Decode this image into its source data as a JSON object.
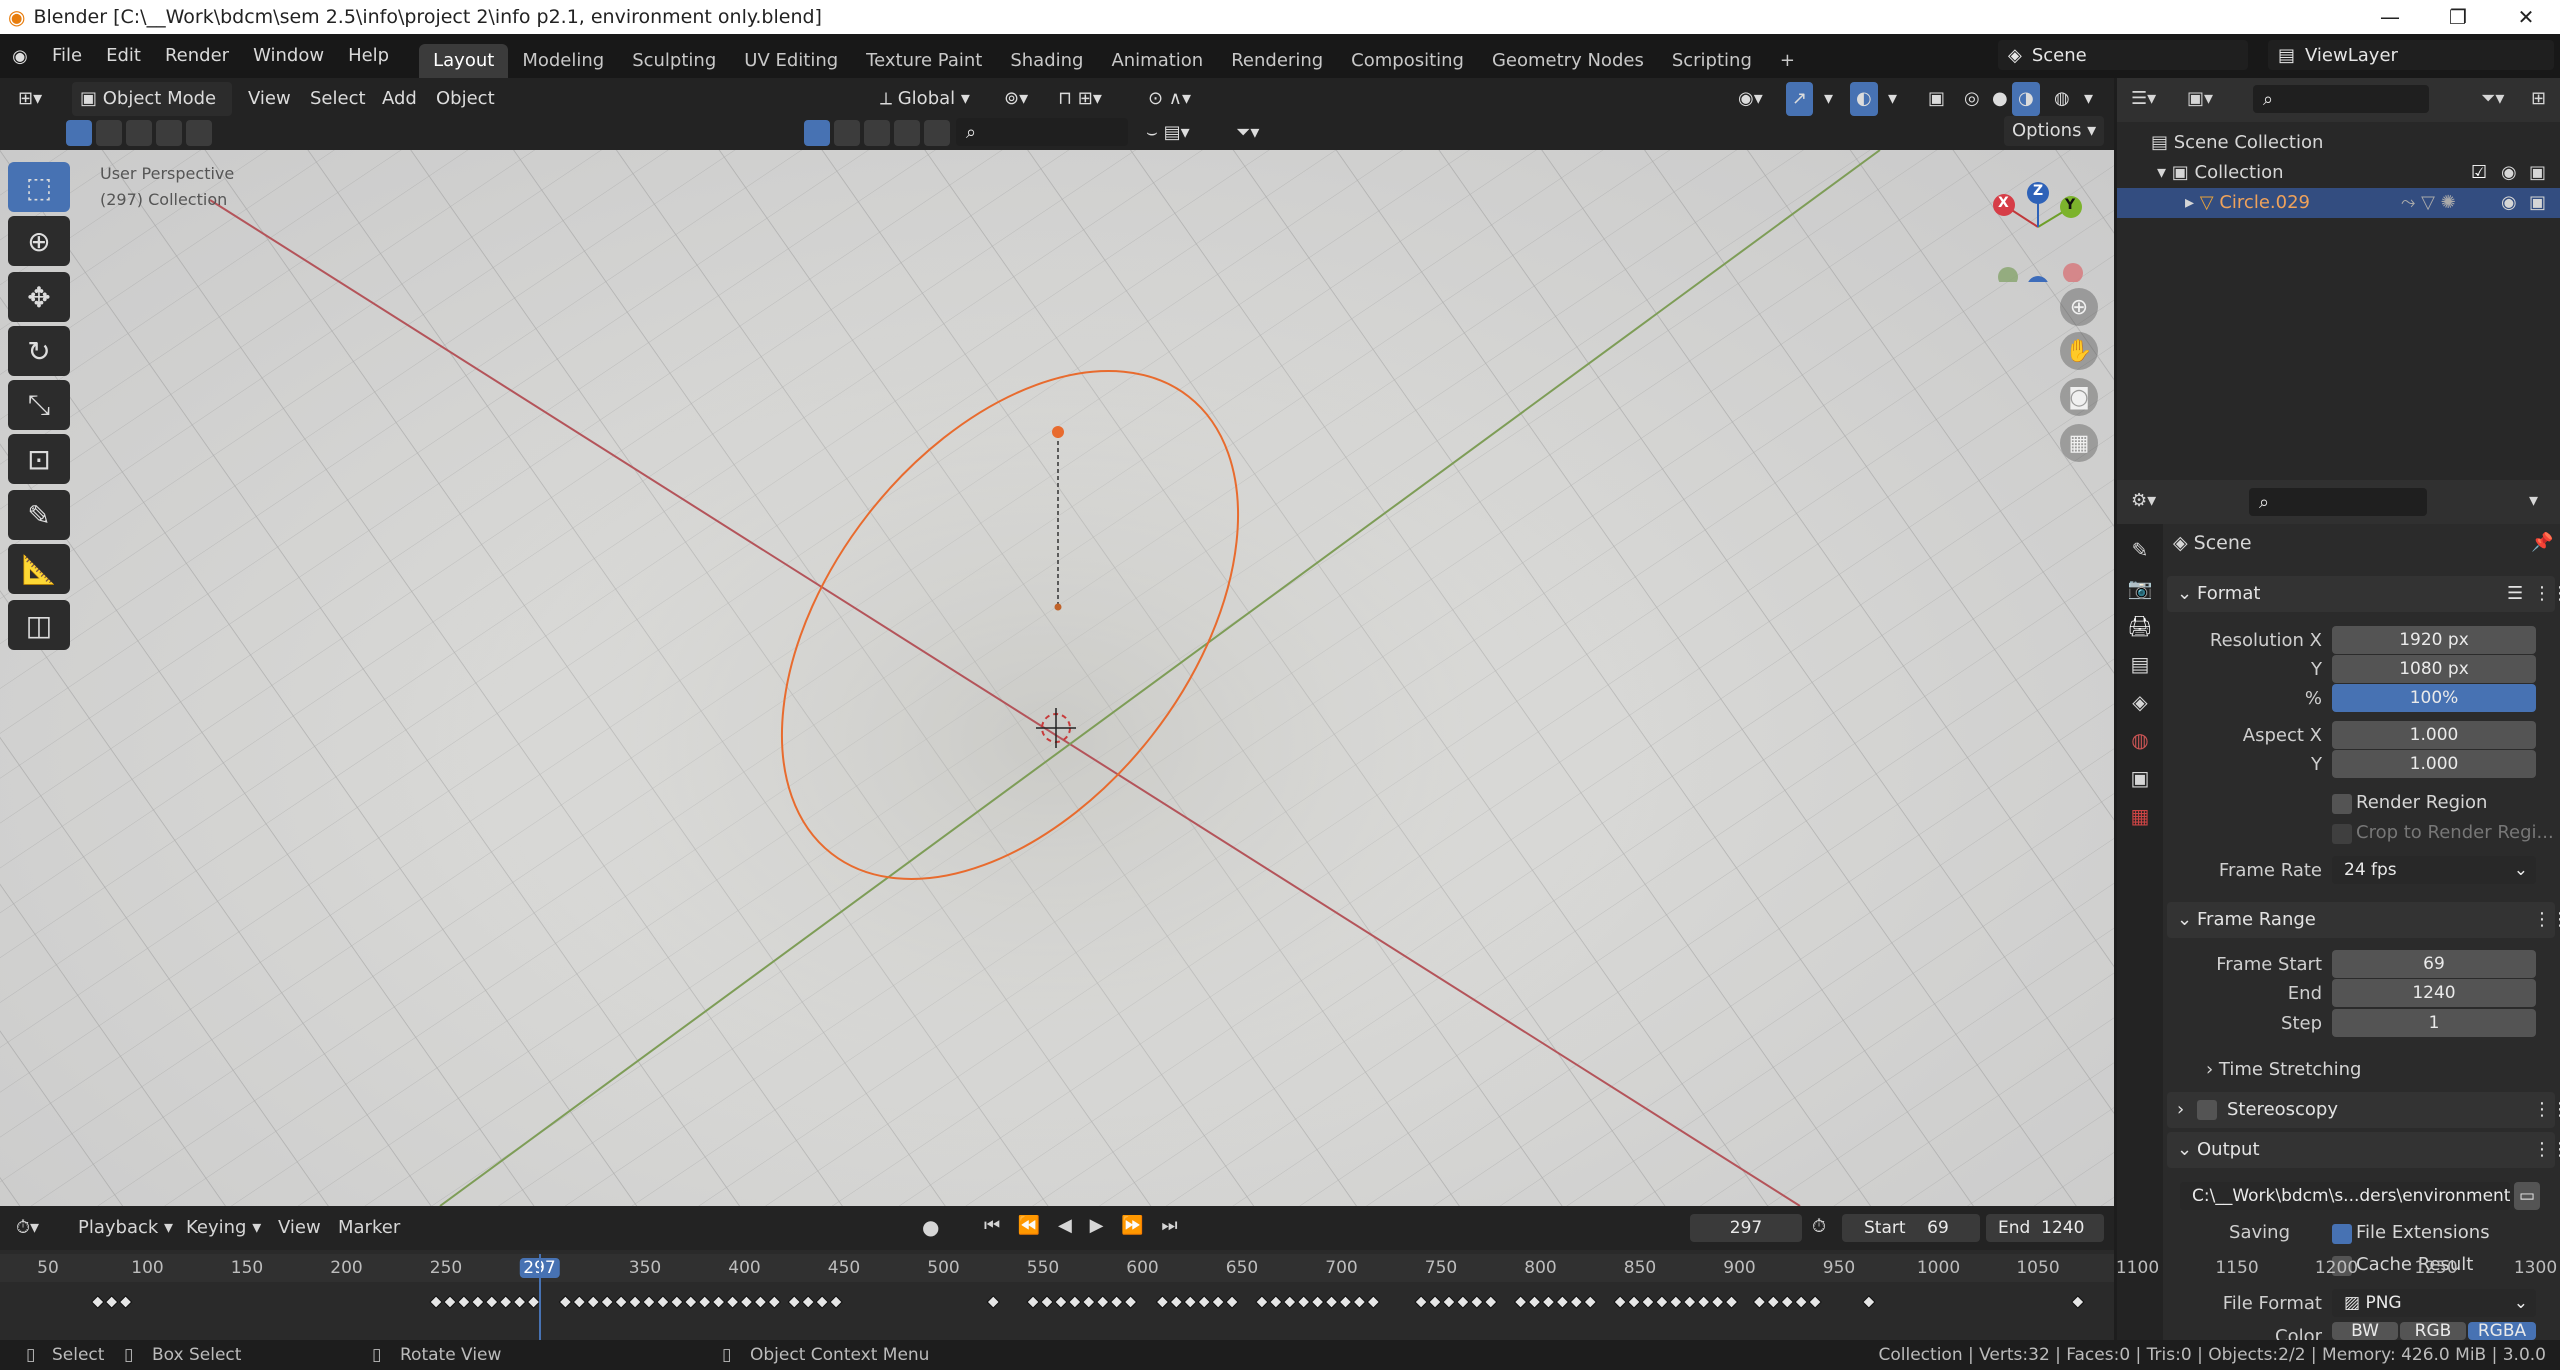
{
  "titlebar": {
    "title": "Blender [C:\\__Work\\bdcm\\sem 2.5\\info\\project 2\\info p2.1, environment only.blend]"
  },
  "menu": {
    "items": [
      "File",
      "Edit",
      "Render",
      "Window",
      "Help"
    ]
  },
  "workspaces": [
    "Layout",
    "Modeling",
    "Sculpting",
    "UV Editing",
    "Texture Paint",
    "Shading",
    "Animation",
    "Rendering",
    "Compositing",
    "Geometry Nodes",
    "Scripting"
  ],
  "scene_field": "Scene",
  "viewlayer_field": "ViewLayer",
  "header3d": {
    "mode": "Object Mode",
    "view": "View",
    "select": "Select",
    "add": "Add",
    "object": "Object",
    "transform": "Global",
    "options": "Options"
  },
  "viewport": {
    "perspective": "User Perspective",
    "collection_info": "(297) Collection"
  },
  "gizmo": {
    "x": "X",
    "y": "Y",
    "z": "Z"
  },
  "colors": {
    "accent": "#4772b3",
    "selected_object": "#e86b2e",
    "x_axis": "#c0393b",
    "y_axis": "#6e9f2a",
    "z_axis": "#2e62b8"
  },
  "outliner": {
    "scene_collection": "Scene Collection",
    "collection": "Collection",
    "object": "Circle.029"
  },
  "properties": {
    "context": "Scene",
    "format": {
      "title": "Format",
      "res_x_label": "Resolution X",
      "res_x": "1920 px",
      "res_y_label": "Y",
      "res_y": "1080 px",
      "pct_label": "%",
      "pct": "100%",
      "aspect_x_label": "Aspect X",
      "aspect_x": "1.000",
      "aspect_y_label": "Y",
      "aspect_y": "1.000",
      "render_region": "Render Region",
      "crop": "Crop to Render Regi...",
      "frame_rate_label": "Frame Rate",
      "frame_rate": "24 fps"
    },
    "frame_range": {
      "title": "Frame Range",
      "start_label": "Frame Start",
      "start": "69",
      "end_label": "End",
      "end": "1240",
      "step_label": "Step",
      "step": "1",
      "time_stretching": "Time Stretching"
    },
    "stereoscopy": "Stereoscopy",
    "output": {
      "title": "Output",
      "path": "C:\\__Work\\bdcm\\s...ders\\environment\\",
      "saving_label": "Saving",
      "file_ext": "File Extensions",
      "cache": "Cache Result",
      "format_label": "File Format",
      "format": "PNG",
      "color_label": "Color",
      "color_opts": [
        "BW",
        "RGB",
        "RGBA"
      ]
    }
  },
  "timeline": {
    "menus": [
      "Playback",
      "Keying",
      "View",
      "Marker"
    ],
    "current": "297",
    "start_label": "Start",
    "start": "69",
    "end_label": "End",
    "end": "1240",
    "ticks": [
      "50",
      "100",
      "150",
      "200",
      "250",
      "297",
      "350",
      "400",
      "450",
      "500",
      "550",
      "600",
      "650",
      "700",
      "750",
      "800",
      "850",
      "900",
      "950",
      "1000",
      "1050",
      "1100",
      "1150",
      "1200",
      "1250",
      "1300"
    ]
  },
  "status": {
    "select": "Select",
    "box_select": "Box Select",
    "rotate": "Rotate View",
    "context_menu": "Object Context Menu",
    "stats": "Collection | Verts:32 | Faces:0 | Tris:0 | Objects:2/2 | Memory: 426.0 MiB | 3.0.0"
  }
}
